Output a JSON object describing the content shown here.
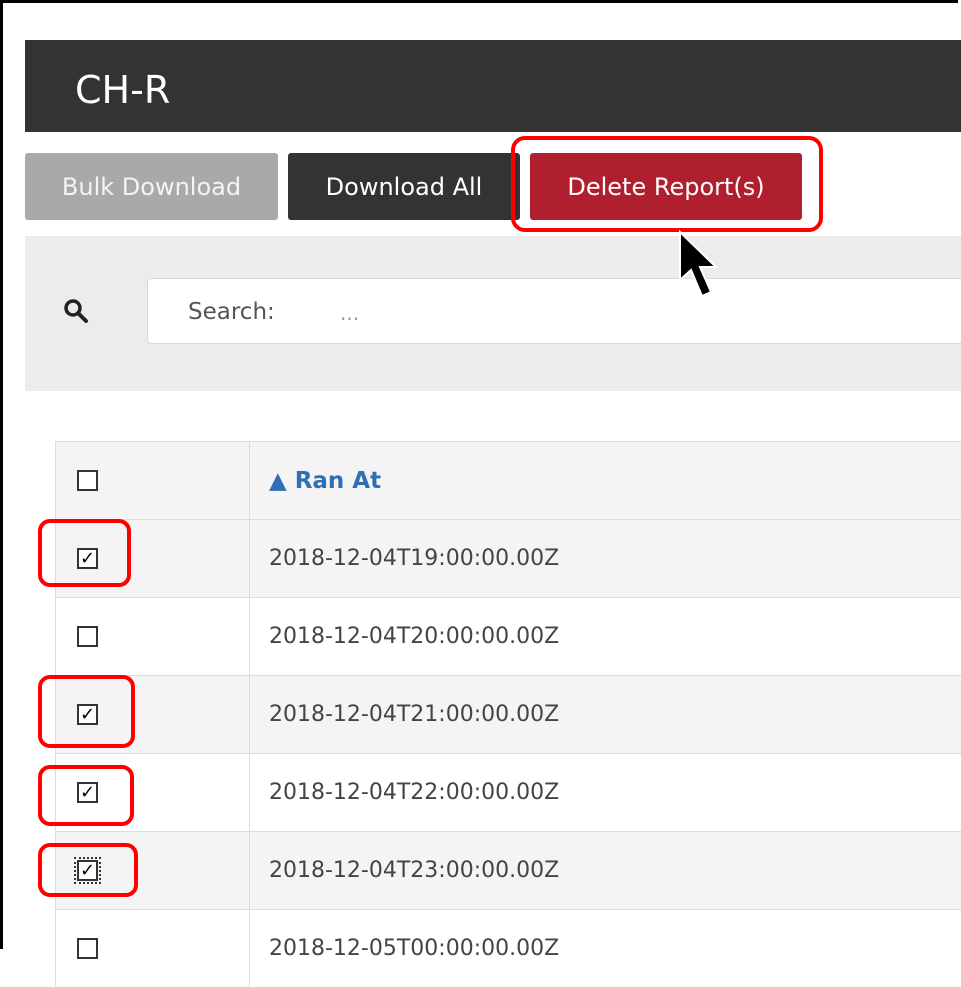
{
  "header": {
    "title": "CH-R"
  },
  "toolbar": {
    "bulk_download_label": "Bulk Download",
    "download_all_label": "Download All",
    "delete_reports_label": "Delete Report(s)"
  },
  "search": {
    "label": "Search:",
    "placeholder": "..."
  },
  "table": {
    "column_header": "▲ Ran At",
    "header_checked": false,
    "rows": [
      {
        "ran_at": "2018-12-04T19:00:00.00Z",
        "checked": true
      },
      {
        "ran_at": "2018-12-04T20:00:00.00Z",
        "checked": false
      },
      {
        "ran_at": "2018-12-04T21:00:00.00Z",
        "checked": true
      },
      {
        "ran_at": "2018-12-04T22:00:00.00Z",
        "checked": true
      },
      {
        "ran_at": "2018-12-04T23:00:00.00Z",
        "checked": true
      },
      {
        "ran_at": "2018-12-05T00:00:00.00Z",
        "checked": false
      }
    ]
  },
  "colors": {
    "header_bg": "#333333",
    "delete_button": "#b01f2e",
    "highlight": "#ff0000",
    "link_blue": "#2f6fb3"
  },
  "icons": {
    "search": "search-icon",
    "cursor": "mouse-pointer-icon"
  }
}
